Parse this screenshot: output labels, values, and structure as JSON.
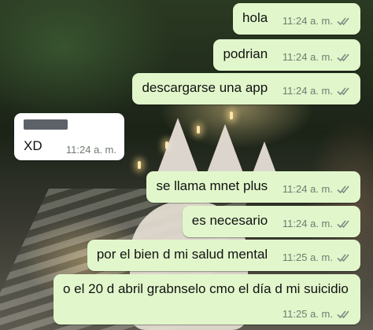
{
  "chat": {
    "messages": [
      {
        "text": "hola",
        "time": "11:24 a. m."
      },
      {
        "text": "podrian",
        "time": "11:24 a. m."
      },
      {
        "text": "descargarse una app",
        "time": "11:24 a. m."
      },
      {
        "text": "XD",
        "time": "11:24 a. m.",
        "sender_redacted": true
      },
      {
        "text": "se llama mnet plus",
        "time": "11:24 a. m."
      },
      {
        "text": "es necesario",
        "time": "11:24 a. m."
      },
      {
        "text": "por el bien d mi salud mental",
        "time": "11:25 a. m."
      },
      {
        "text": "o el 20 d abril grabnselo cmo el día d mi suicidio",
        "time": "11:25 a. m."
      }
    ]
  },
  "icons": {
    "read_receipt": "double-check-icon"
  },
  "colors": {
    "outgoing": "#e1f7cb",
    "incoming": "#ffffff",
    "ticks": "#7d8a83"
  }
}
